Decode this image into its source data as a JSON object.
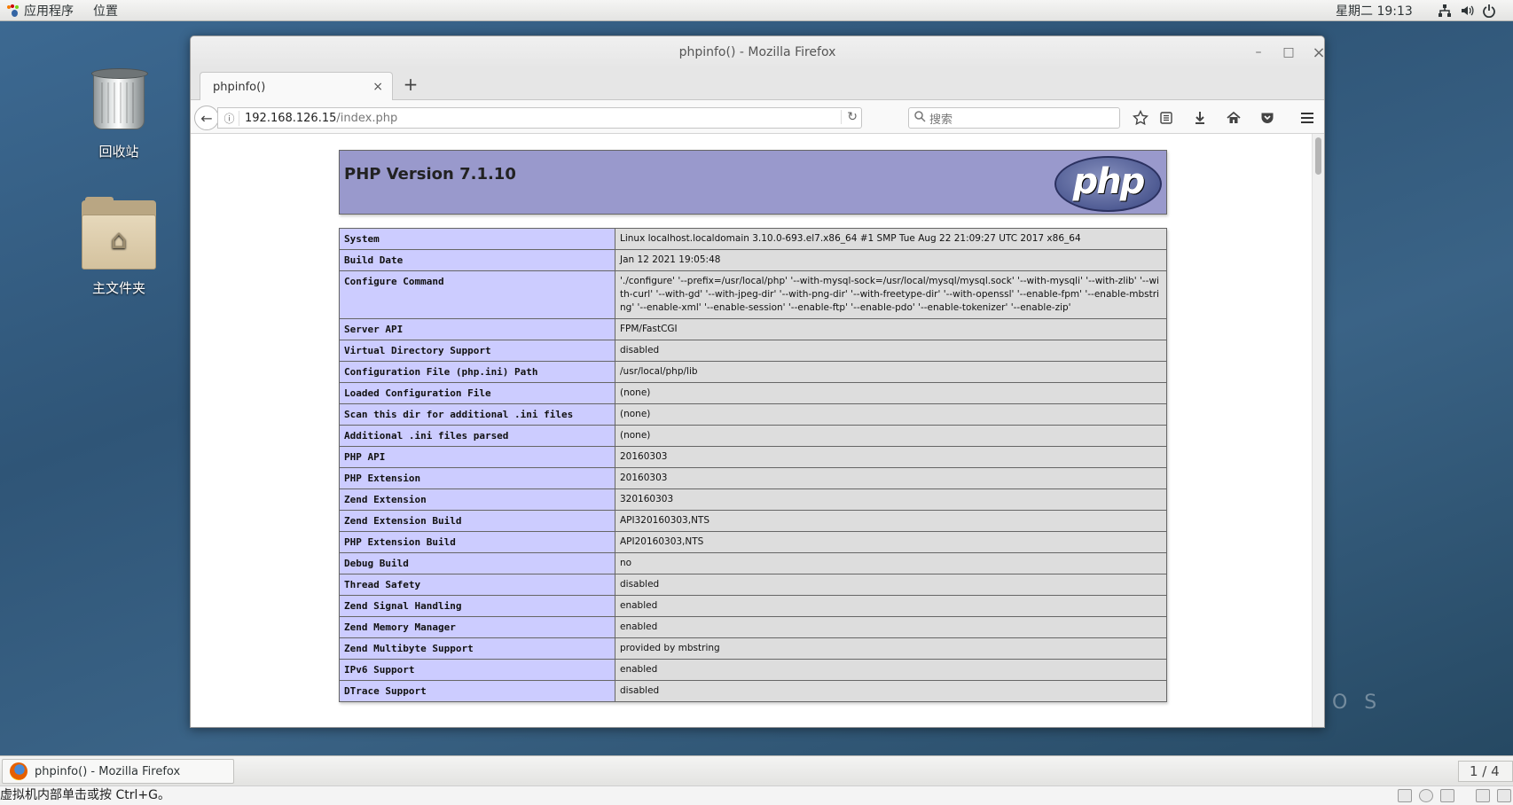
{
  "top_panel": {
    "applications": "应用程序",
    "places": "位置",
    "clock": "星期二 19:13"
  },
  "desktop": {
    "trash_label": "回收站",
    "home_label": "主文件夹",
    "watermark": "O S"
  },
  "window": {
    "title": "phpinfo() - Mozilla Firefox",
    "minimize": "–",
    "maximize": "□",
    "close": "×"
  },
  "tabs": [
    {
      "label": "phpinfo()",
      "close": "×"
    }
  ],
  "new_tab": "+",
  "navbar": {
    "back": "←",
    "info": "ⓘ",
    "url_host": "192.168.126.15",
    "url_path": "/index.php",
    "reload": "↻",
    "search_icon": "🔍",
    "search_placeholder": "搜索"
  },
  "toolbar_icons": [
    "star-icon",
    "reading-list-icon",
    "download-icon",
    "home-icon",
    "pocket-icon",
    "menu-icon"
  ],
  "page": {
    "version_title": "PHP Version 7.1.10",
    "logo_text": "php",
    "rows": [
      {
        "key": "System",
        "value": "Linux localhost.localdomain 3.10.0-693.el7.x86_64 #1 SMP Tue Aug 22 21:09:27 UTC 2017 x86_64"
      },
      {
        "key": "Build Date",
        "value": "Jan 12 2021 19:05:48"
      },
      {
        "key": "Configure Command",
        "value": "'./configure' '--prefix=/usr/local/php' '--with-mysql-sock=/usr/local/mysql/mysql.sock' '--with-mysqli' '--with-zlib' '--with-curl' '--with-gd' '--with-jpeg-dir' '--with-png-dir' '--with-freetype-dir' '--with-openssl' '--enable-fpm' '--enable-mbstring' '--enable-xml' '--enable-session' '--enable-ftp' '--enable-pdo' '--enable-tokenizer' '--enable-zip'"
      },
      {
        "key": "Server API",
        "value": "FPM/FastCGI"
      },
      {
        "key": "Virtual Directory Support",
        "value": "disabled"
      },
      {
        "key": "Configuration File (php.ini) Path",
        "value": "/usr/local/php/lib"
      },
      {
        "key": "Loaded Configuration File",
        "value": "(none)"
      },
      {
        "key": "Scan this dir for additional .ini files",
        "value": "(none)"
      },
      {
        "key": "Additional .ini files parsed",
        "value": "(none)"
      },
      {
        "key": "PHP API",
        "value": "20160303"
      },
      {
        "key": "PHP Extension",
        "value": "20160303"
      },
      {
        "key": "Zend Extension",
        "value": "320160303"
      },
      {
        "key": "Zend Extension Build",
        "value": "API320160303,NTS"
      },
      {
        "key": "PHP Extension Build",
        "value": "API20160303,NTS"
      },
      {
        "key": "Debug Build",
        "value": "no"
      },
      {
        "key": "Thread Safety",
        "value": "disabled"
      },
      {
        "key": "Zend Signal Handling",
        "value": "enabled"
      },
      {
        "key": "Zend Memory Manager",
        "value": "enabled"
      },
      {
        "key": "Zend Multibyte Support",
        "value": "provided by mbstring"
      },
      {
        "key": "IPv6 Support",
        "value": "enabled"
      },
      {
        "key": "DTrace Support",
        "value": "disabled"
      }
    ]
  },
  "taskbar": {
    "task_label": "phpinfo() - Mozilla Firefox",
    "workspace": "1 / 4"
  },
  "statusbar": {
    "hint": "虚拟机内部单击或按 Ctrl+G。"
  },
  "colors": {
    "php_header": "#9999cc",
    "key_cell": "#ccccff",
    "value_cell": "#dddddd"
  }
}
